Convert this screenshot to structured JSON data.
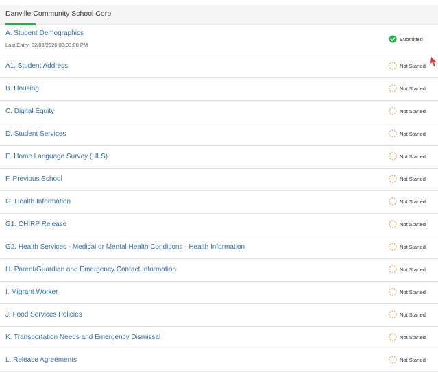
{
  "header": {
    "title": "Danville Community School Corp"
  },
  "colors": {
    "accent_green": "#22b14c",
    "link_blue": "#2f6fb3",
    "not_started_orange": "#f0a05a",
    "pointer_red": "#d9383a"
  },
  "sections": [
    {
      "label": "A. Student Demographics",
      "sub": "Last Entry: 02/03/2026 03:03:00 PM",
      "status": "Submitted",
      "icon": "check-circle-icon"
    },
    {
      "label": "A1. Student Address",
      "status": "Not Started",
      "icon": "dashed-circle-icon"
    },
    {
      "label": "B. Housing",
      "status": "Not Started",
      "icon": "dashed-circle-icon"
    },
    {
      "label": "C. Digital Equity",
      "status": "Not Started",
      "icon": "dashed-circle-icon"
    },
    {
      "label": "D. Student Services",
      "status": "Not Started",
      "icon": "dashed-circle-icon"
    },
    {
      "label": "E. Home Language Survey (HLS)",
      "status": "Not Started",
      "icon": "dashed-circle-icon"
    },
    {
      "label": "F. Previous School",
      "status": "Not Started",
      "icon": "dashed-circle-icon"
    },
    {
      "label": "G. Health Information",
      "status": "Not Started",
      "icon": "dashed-circle-icon"
    },
    {
      "label": "G1. CHIRP Release",
      "status": "Not Started",
      "icon": "dashed-circle-icon"
    },
    {
      "label": "G2. Health Services - Medical or Mental Health Conditions - Health Information",
      "status": "Not Started",
      "icon": "dashed-circle-icon"
    },
    {
      "label": "H. Parent/Guardian and Emergency Contact Information",
      "status": "Not Started",
      "icon": "dashed-circle-icon"
    },
    {
      "label": "I. Migrant Worker",
      "status": "Not Started",
      "icon": "dashed-circle-icon"
    },
    {
      "label": "J. Food Services Policies",
      "status": "Not Started",
      "icon": "dashed-circle-icon"
    },
    {
      "label": "K. Transportation Needs and Emergency Dismissal",
      "status": "Not Started",
      "icon": "dashed-circle-icon"
    },
    {
      "label": "L. Release Agreements",
      "status": "Not Started",
      "icon": "dashed-circle-icon"
    }
  ]
}
